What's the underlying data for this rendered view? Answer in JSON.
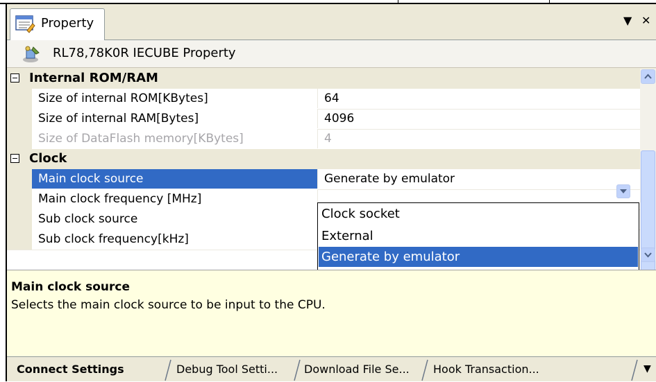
{
  "tab": {
    "label": "Property",
    "menu_glyph": "▼",
    "close_glyph": "✕",
    "icon": "property-window-icon"
  },
  "header": {
    "title": "RL78,78K0R IECUBE Property",
    "icon": "debug-tool-icon"
  },
  "categories": [
    {
      "name": "Internal ROM/RAM",
      "rows": [
        {
          "key": "Size of internal ROM[KBytes]",
          "value": "64",
          "disabled": false
        },
        {
          "key": "Size of internal RAM[Bytes]",
          "value": "4096",
          "disabled": false
        },
        {
          "key": "Size of DataFlash memory[KBytes]",
          "value": "4",
          "disabled": true
        }
      ]
    },
    {
      "name": "Clock",
      "rows": [
        {
          "key": "Main clock source",
          "value": "Generate by emulator",
          "selected": true
        },
        {
          "key": "Main clock frequency [MHz]",
          "value": ""
        },
        {
          "key": "Sub clock source",
          "value": ""
        },
        {
          "key": "Sub clock frequency[kHz]",
          "value": ""
        }
      ]
    }
  ],
  "dropdown": {
    "options": [
      "Clock socket",
      "External",
      "Generate by emulator"
    ],
    "selected": "Generate by emulator"
  },
  "description": {
    "title": "Main clock source",
    "text": "Selects the main clock source to be input to the CPU."
  },
  "bottom_tabs": [
    {
      "label": "Connect Settings",
      "active": true
    },
    {
      "label": "Debug Tool Setti...",
      "active": false
    },
    {
      "label": "Download File Se...",
      "active": false
    },
    {
      "label": "Hook Transaction...",
      "active": false
    }
  ],
  "bottom_tabs_more_glyph": "▼",
  "colors": {
    "selection": "#316ac5",
    "description_bg": "#ffffe1",
    "panel": "#ece9d8"
  }
}
